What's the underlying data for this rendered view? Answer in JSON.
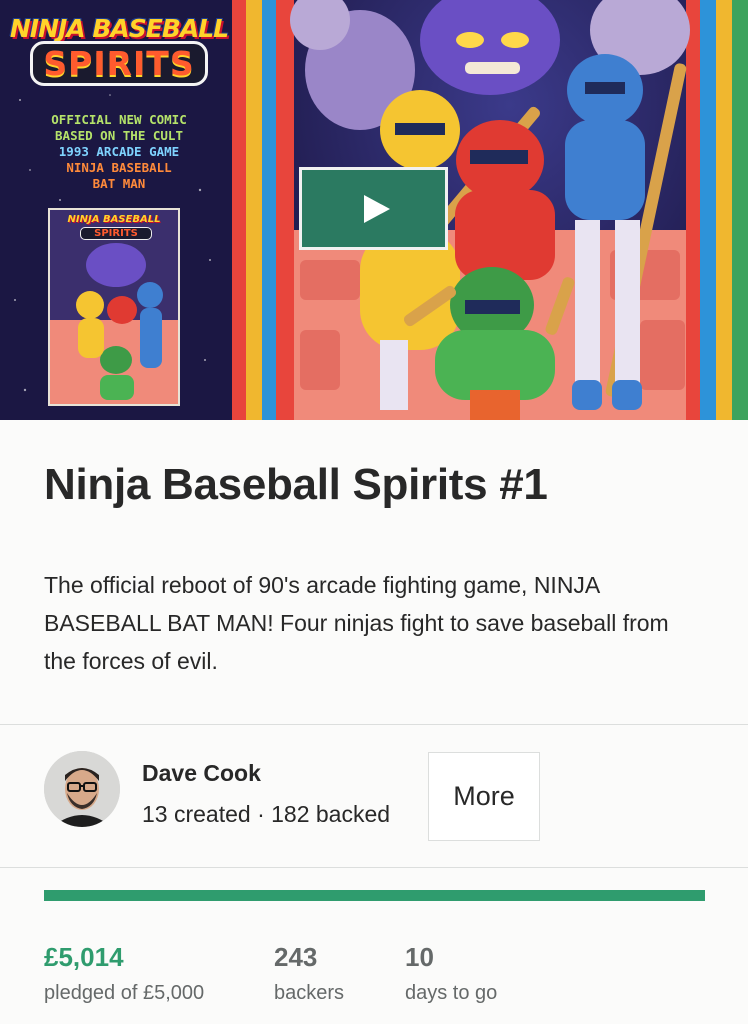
{
  "hero": {
    "logo_line1": "NINJA BASEBALL",
    "logo_line2": "SPIRITS",
    "promo_lines": [
      "OFFICIAL NEW COMIC",
      "BASED ON THE CULT",
      "1993 ARCADE GAME",
      "NINJA BASEBALL",
      "BAT MAN"
    ],
    "mini_cover_title": "NINJA BASEBALL",
    "mini_cover_subtitle": "SPIRITS",
    "play_icon": "play-icon"
  },
  "project": {
    "title": "Ninja Baseball Spirits #1",
    "blurb": "The official reboot of 90's arcade fighting game, NINJA BASEBALL BAT MAN! Four ninjas fight to save baseball from the forces of evil."
  },
  "creator": {
    "name": "Dave Cook",
    "stats": "13 created · 182 backed",
    "more_label": "More"
  },
  "funding": {
    "progress_fraction": 1.0,
    "pledged_value": "£5,014",
    "pledged_label": "pledged of £5,000",
    "backers_value": "243",
    "backers_label": "backers",
    "days_value": "10",
    "days_label": "days to go"
  },
  "colors": {
    "accent_green": "#2f9c6e",
    "play_button_bg": "#2b7a61"
  }
}
